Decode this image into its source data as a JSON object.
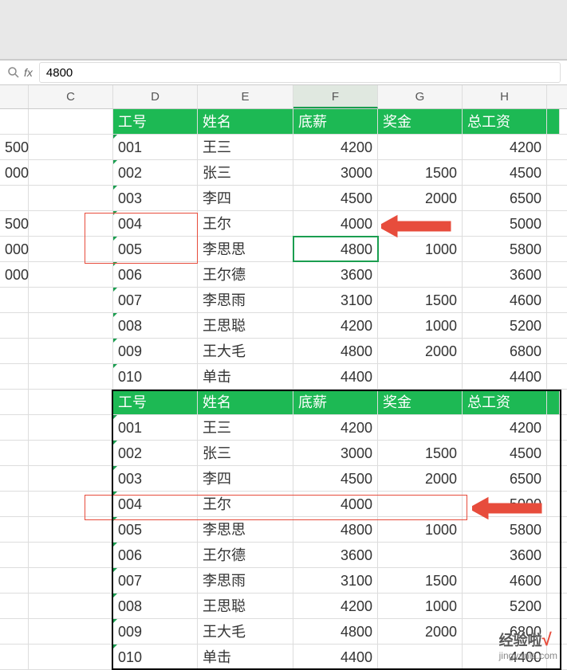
{
  "formula_bar": {
    "fx": "fx",
    "value": "4800"
  },
  "columns": [
    "C",
    "D",
    "E",
    "F",
    "G",
    "H"
  ],
  "active_column": "F",
  "top_table": {
    "headers": [
      "工号",
      "姓名",
      "底薪",
      "奖金",
      "总工资"
    ],
    "rows": [
      {
        "b": "500",
        "gh": "001",
        "xm": "王三",
        "dx": "4200",
        "jj": "",
        "zg": "4200"
      },
      {
        "b": "000",
        "gh": "002",
        "xm": "张三",
        "dx": "3000",
        "jj": "1500",
        "zg": "4500"
      },
      {
        "b": "",
        "gh": "003",
        "xm": "李四",
        "dx": "4500",
        "jj": "2000",
        "zg": "6500"
      },
      {
        "b": "500",
        "gh": "004",
        "xm": "王尔",
        "dx": "4000",
        "jj": "",
        "zg": "5000"
      },
      {
        "b": "000",
        "gh": "005",
        "xm": "李思思",
        "dx": "4800",
        "jj": "1000",
        "zg": "5800"
      },
      {
        "b": "000",
        "gh": "006",
        "xm": "王尔德",
        "dx": "3600",
        "jj": "",
        "zg": "3600"
      },
      {
        "b": "",
        "gh": "007",
        "xm": "李思雨",
        "dx": "3100",
        "jj": "1500",
        "zg": "4600"
      },
      {
        "b": "",
        "gh": "008",
        "xm": "王思聪",
        "dx": "4200",
        "jj": "1000",
        "zg": "5200"
      },
      {
        "b": "",
        "gh": "009",
        "xm": "王大毛",
        "dx": "4800",
        "jj": "2000",
        "zg": "6800"
      },
      {
        "b": "",
        "gh": "010",
        "xm": "单击",
        "dx": "4400",
        "jj": "",
        "zg": "4400"
      }
    ]
  },
  "bottom_table": {
    "headers": [
      "工号",
      "姓名",
      "底薪",
      "奖金",
      "总工资"
    ],
    "rows": [
      {
        "gh": "001",
        "xm": "王三",
        "dx": "4200",
        "jj": "",
        "zg": "4200"
      },
      {
        "gh": "002",
        "xm": "张三",
        "dx": "3000",
        "jj": "1500",
        "zg": "4500"
      },
      {
        "gh": "003",
        "xm": "李四",
        "dx": "4500",
        "jj": "2000",
        "zg": "6500"
      },
      {
        "gh": "004",
        "xm": "王尔",
        "dx": "4000",
        "jj": "",
        "zg": "5000"
      },
      {
        "gh": "005",
        "xm": "李思思",
        "dx": "4800",
        "jj": "1000",
        "zg": "5800"
      },
      {
        "gh": "006",
        "xm": "王尔德",
        "dx": "3600",
        "jj": "",
        "zg": "3600"
      },
      {
        "gh": "007",
        "xm": "李思雨",
        "dx": "3100",
        "jj": "1500",
        "zg": "4600"
      },
      {
        "gh": "008",
        "xm": "王思聪",
        "dx": "4200",
        "jj": "1000",
        "zg": "5200"
      },
      {
        "gh": "009",
        "xm": "王大毛",
        "dx": "4800",
        "jj": "2000",
        "zg": "6800"
      },
      {
        "gh": "010",
        "xm": "单击",
        "dx": "4400",
        "jj": "",
        "zg": "4400"
      }
    ]
  },
  "watermark": {
    "text": "经验啦",
    "url": "jingyanla.com"
  }
}
